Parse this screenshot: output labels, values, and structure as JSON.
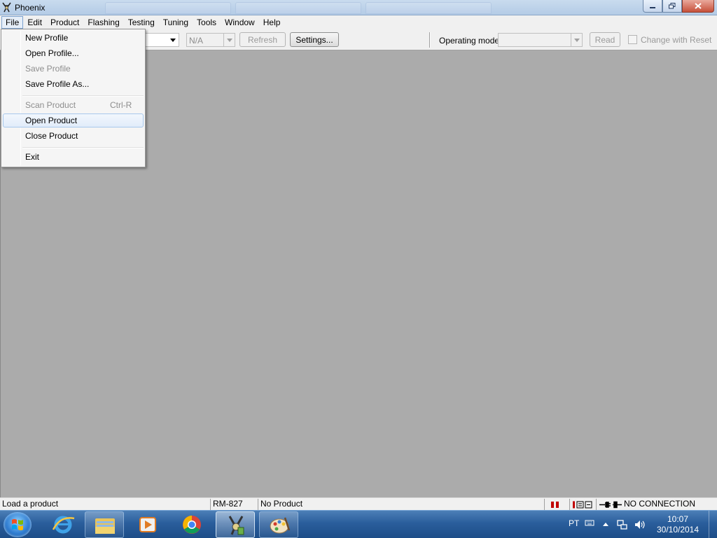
{
  "window": {
    "title": "Phoenix"
  },
  "menubar": {
    "items": [
      "File",
      "Edit",
      "Product",
      "Flashing",
      "Testing",
      "Tuning",
      "Tools",
      "Window",
      "Help"
    ],
    "active": "File"
  },
  "file_menu": {
    "new_profile": "New Profile",
    "open_profile": "Open Profile...",
    "save_profile": "Save Profile",
    "save_profile_as": "Save Profile As...",
    "scan_product": "Scan Product",
    "scan_product_shortcut": "Ctrl-R",
    "open_product": "Open Product",
    "close_product": "Close Product",
    "exit": "Exit"
  },
  "toolbar": {
    "na_value": "N/A",
    "refresh_label": "Refresh",
    "settings_label": "Settings...",
    "operating_mode_label": "Operating mode:",
    "operating_mode_value": "",
    "read_label": "Read",
    "change_with_reset_label": "Change with Reset"
  },
  "statusbar": {
    "message": "Load a product",
    "product_code": "RM-827",
    "product_name": "No Product",
    "connection": "NO CONNECTION"
  },
  "taskbar": {
    "language": "PT",
    "time": "10:07",
    "date": "30/10/2014",
    "apps": [
      "internet-explorer",
      "file-explorer",
      "media-player",
      "chrome",
      "phoenix",
      "paint"
    ]
  },
  "colors": {
    "mdi_background": "#ababab",
    "taskbar_blue": "#2a5e9c",
    "status_red": "#c00000"
  }
}
